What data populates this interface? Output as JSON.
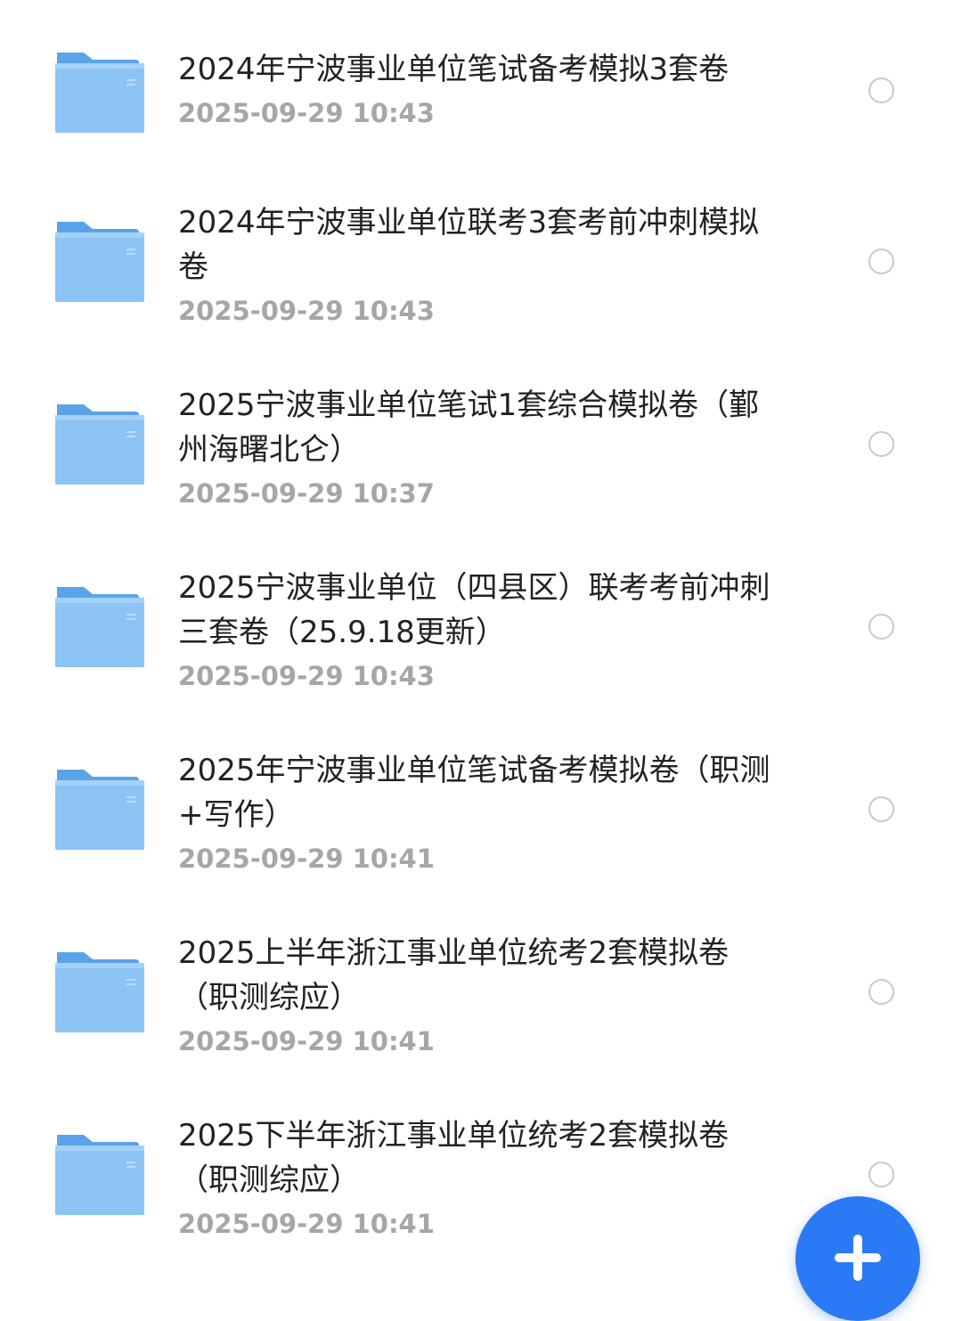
{
  "files": [
    {
      "name": "2024年宁波事业单位笔试备考模拟3套卷",
      "date": "2025-09-29 10:43",
      "icon": "folder-icon",
      "selected": false
    },
    {
      "name": "2024年宁波事业单位联考3套考前冲刺模拟卷",
      "date": "2025-09-29 10:43",
      "icon": "folder-icon",
      "selected": false
    },
    {
      "name": "2025宁波事业单位笔试1套综合模拟卷（鄞州海曙北仑）",
      "date": "2025-09-29 10:37",
      "icon": "folder-icon",
      "selected": false
    },
    {
      "name": "2025宁波事业单位（四县区）联考考前冲刺三套卷（25.9.18更新）",
      "date": "2025-09-29 10:43",
      "icon": "folder-icon",
      "selected": false
    },
    {
      "name": "2025年宁波事业单位笔试备考模拟卷（职测+写作）",
      "date": "2025-09-29 10:41",
      "icon": "folder-icon",
      "selected": false
    },
    {
      "name": "2025上半年浙江事业单位统考2套模拟卷（职测综应）",
      "date": "2025-09-29 10:41",
      "icon": "folder-icon",
      "selected": false
    },
    {
      "name": "2025下半年浙江事业单位统考2套模拟卷（职测综应）",
      "date": "2025-09-29 10:41",
      "icon": "folder-icon",
      "selected": false
    }
  ],
  "fab": {
    "icon": "plus-icon",
    "color": "#2a7af5"
  },
  "colors": {
    "folder_top": "#6fb0ee",
    "folder_body": "#8cc4f6",
    "title_text": "#222222",
    "date_text": "#a6a6a6",
    "radio_border": "#c9c9c9"
  }
}
